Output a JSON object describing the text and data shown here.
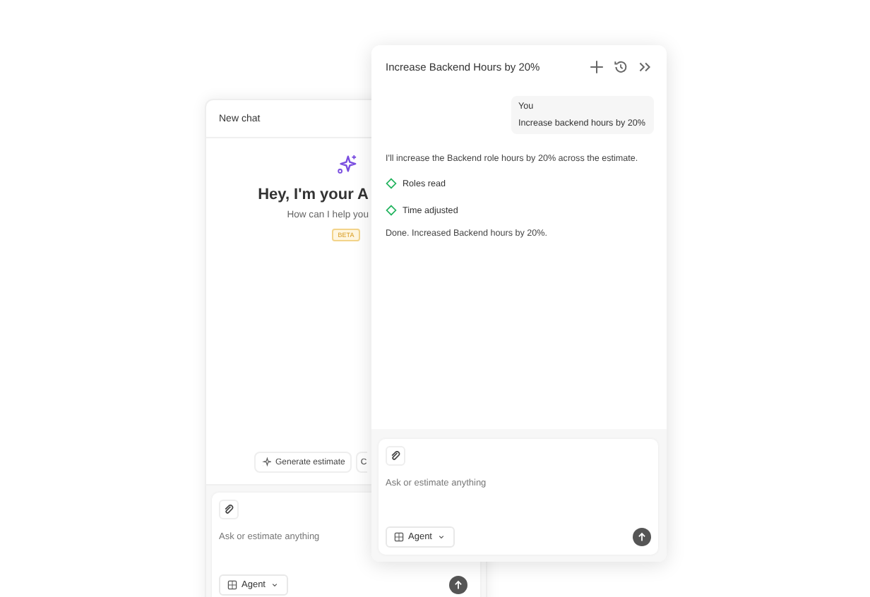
{
  "back_chat": {
    "title": "New chat",
    "greeting": "Hey, I'm your A",
    "subtitle": "How can I help you",
    "badge": "BETA",
    "suggestions": [
      "Generate estimate",
      "C"
    ],
    "composer": {
      "placeholder": "Ask or estimate anything",
      "mode": "Agent"
    }
  },
  "front_chat": {
    "title": "Increase Backend Hours by 20%",
    "messages": [
      {
        "kind": "user",
        "author": "You",
        "text": "Increase backend hours by 20%"
      },
      {
        "kind": "assistant",
        "text": "I'll increase the Backend role hours by 20% across the estimate."
      },
      {
        "kind": "step",
        "text": "Roles read"
      },
      {
        "kind": "step",
        "text": "Time adjusted"
      },
      {
        "kind": "assistant",
        "text": "Done. Increased Backend hours by 20%."
      }
    ],
    "composer": {
      "placeholder": "Ask or estimate anything",
      "mode": "Agent"
    }
  }
}
